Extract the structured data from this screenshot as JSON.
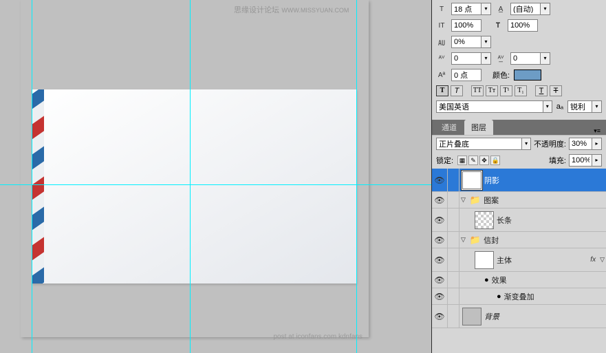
{
  "watermark": {
    "text": "思缘设计论坛",
    "url": "WWW.MISSYUAN.COM"
  },
  "footer": "post at iconfans.com  kdnfans",
  "char": {
    "fontSize": "18 点",
    "leading": "(自动)",
    "vscale": "100%",
    "hscale": "100%",
    "tracking_a": "0%",
    "kerning": "0",
    "tracking_v": "0",
    "baseline": "0 点",
    "colorLabel": "颜色:",
    "lang": "美国英语",
    "aa_prefix": "aₐ",
    "aa": "锐利"
  },
  "layers": {
    "tabChannels": "通道",
    "tabLayers": "图层",
    "blend": "正片叠底",
    "opacityLabel": "不透明度:",
    "opacity": "30%",
    "lockLabel": "锁定:",
    "fillLabel": "填充:",
    "fill": "100%",
    "items": {
      "shadow": "阴影",
      "pattern": "图案",
      "bar": "长条",
      "envelope": "信封",
      "body": "主体",
      "effects": "效果",
      "gradOverlay": "渐变叠加",
      "background": "背景"
    }
  }
}
